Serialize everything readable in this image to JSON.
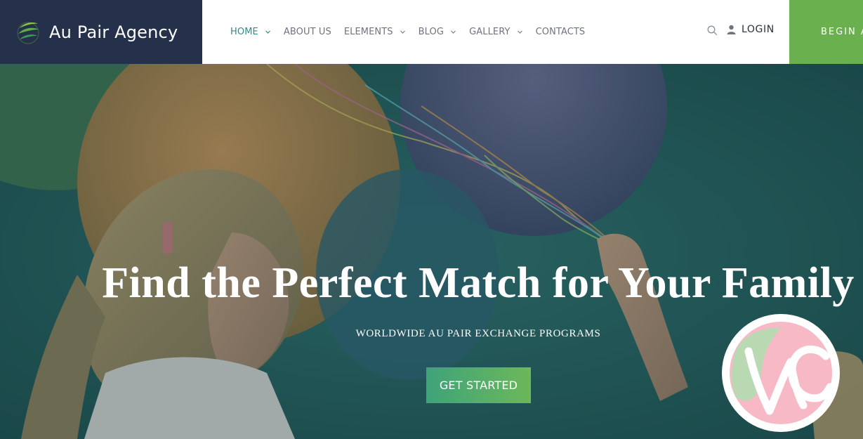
{
  "brand": {
    "name": "Au Pair Agency",
    "icon": "leaf-swirl-logo-icon"
  },
  "nav": {
    "items": [
      {
        "label": "HOME",
        "dropdown": true,
        "active": true
      },
      {
        "label": "ABOUT US",
        "dropdown": false,
        "active": false
      },
      {
        "label": "ELEMENTS",
        "dropdown": true,
        "active": false
      },
      {
        "label": "BLOG",
        "dropdown": true,
        "active": false
      },
      {
        "label": "GALLERY",
        "dropdown": true,
        "active": false
      },
      {
        "label": "CONTACTS",
        "dropdown": false,
        "active": false
      }
    ]
  },
  "header": {
    "search_icon": "search-icon",
    "login_label": "LOGIN",
    "begin_label": "BEGIN A"
  },
  "hero": {
    "title": "Find the Perfect Match for Your Family",
    "subtitle": "WORLDWIDE AU PAIR EXCHANGE PROGRAMS",
    "cta_label": "GET STARTED"
  },
  "colors": {
    "logo_bg": "#25304a",
    "accent_teal": "#2f8b86",
    "accent_green": "#6ab04f",
    "badge_pink": "#f7b9c6",
    "badge_green": "#b9d9b3"
  }
}
